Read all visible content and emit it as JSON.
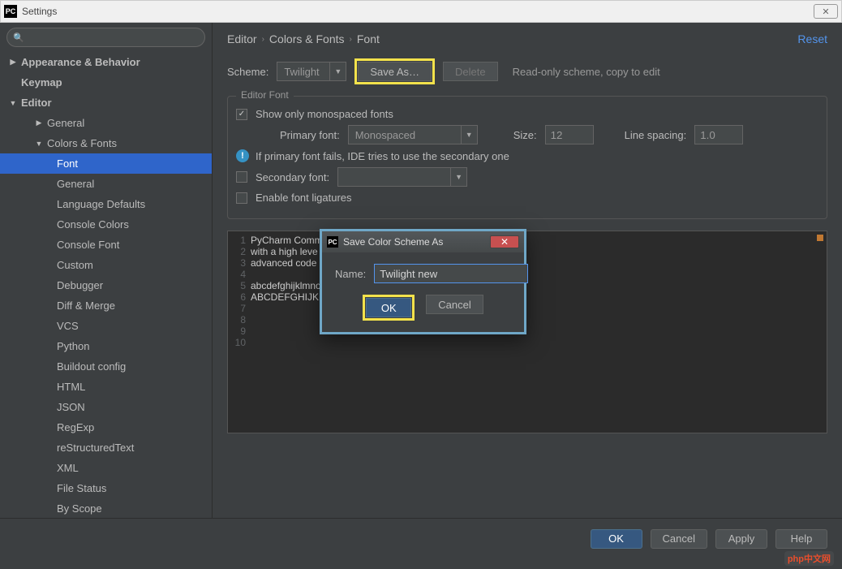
{
  "window": {
    "title": "Settings"
  },
  "sidebar": {
    "search_placeholder": "",
    "items": [
      {
        "label": "Appearance & Behavior",
        "expandable": true,
        "expanded": false,
        "bold": true,
        "level": 0
      },
      {
        "label": "Keymap",
        "expandable": false,
        "bold": true,
        "level": 1
      },
      {
        "label": "Editor",
        "expandable": true,
        "expanded": true,
        "bold": true,
        "level": 0
      },
      {
        "label": "General",
        "expandable": true,
        "expanded": false,
        "level": 2
      },
      {
        "label": "Colors & Fonts",
        "expandable": true,
        "expanded": true,
        "level": 2,
        "selectedParent": true
      },
      {
        "label": "Font",
        "level": 3,
        "selected": true
      },
      {
        "label": "General",
        "level": 3
      },
      {
        "label": "Language Defaults",
        "level": 3
      },
      {
        "label": "Console Colors",
        "level": 3
      },
      {
        "label": "Console Font",
        "level": 3
      },
      {
        "label": "Custom",
        "level": 3
      },
      {
        "label": "Debugger",
        "level": 3
      },
      {
        "label": "Diff & Merge",
        "level": 3
      },
      {
        "label": "VCS",
        "level": 3
      },
      {
        "label": "Python",
        "level": 3
      },
      {
        "label": "Buildout config",
        "level": 3
      },
      {
        "label": "HTML",
        "level": 3
      },
      {
        "label": "JSON",
        "level": 3
      },
      {
        "label": "RegExp",
        "level": 3
      },
      {
        "label": "reStructuredText",
        "level": 3
      },
      {
        "label": "XML",
        "level": 3
      },
      {
        "label": "File Status",
        "level": 3
      },
      {
        "label": "By Scope",
        "level": 3
      }
    ]
  },
  "breadcrumb": {
    "a": "Editor",
    "b": "Colors & Fonts",
    "c": "Font",
    "reset": "Reset"
  },
  "scheme": {
    "label": "Scheme:",
    "value": "Twilight",
    "save_as": "Save As…",
    "delete": "Delete",
    "readonly": "Read-only scheme, copy to edit"
  },
  "editor_font": {
    "title": "Editor Font",
    "show_monospaced": "Show only monospaced fonts",
    "primary_label": "Primary font:",
    "primary_value": "Monospaced",
    "size_label": "Size:",
    "size_value": "12",
    "spacing_label": "Line spacing:",
    "spacing_value": "1.0",
    "fallback_hint": "If primary font fails, IDE tries to use the secondary one",
    "secondary_label": "Secondary font:",
    "ligatures": "Enable font ligatures"
  },
  "preview_lines": [
    "PyCharm Communit",
    "with a high leve",
    "advanced code ed",
    "",
    "abcdefghijklmnopqrstuvwxyz 0123456789 (){}[]",
    "ABCDEFGHIJKLMNOPQRSTUVWXYZ +-*/= .,;:!? #&$%@|^",
    "",
    "",
    "",
    ""
  ],
  "dialog": {
    "title": "Save Color Scheme As",
    "name_label": "Name:",
    "name_value": "Twilight new",
    "ok": "OK",
    "cancel": "Cancel"
  },
  "footer": {
    "ok": "OK",
    "cancel": "Cancel",
    "apply": "Apply",
    "help": "Help"
  },
  "watermark": "php中文网"
}
